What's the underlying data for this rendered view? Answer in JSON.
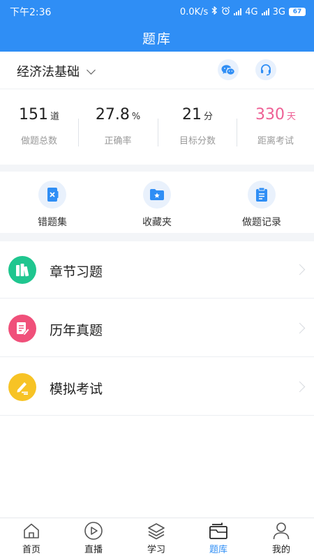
{
  "status_bar": {
    "time": "下午2:36",
    "network_speed": "0.0K/s",
    "net1": "4G",
    "net2": "3G",
    "battery": "67"
  },
  "header": {
    "title": "题库"
  },
  "subject": {
    "name": "经济法基础"
  },
  "stats": [
    {
      "value": "151",
      "unit": "道",
      "label": "做题总数"
    },
    {
      "value": "27.8",
      "unit": "%",
      "label": "正确率"
    },
    {
      "value": "21",
      "unit": "分",
      "label": "目标分数"
    },
    {
      "value": "330",
      "unit": "天",
      "label": "距离考试"
    }
  ],
  "tools": [
    {
      "label": "错题集",
      "icon": "wrong-questions-icon"
    },
    {
      "label": "收藏夹",
      "icon": "favorites-folder-icon"
    },
    {
      "label": "做题记录",
      "icon": "record-clipboard-icon"
    }
  ],
  "menu": [
    {
      "label": "章节习题",
      "icon": "books-icon",
      "color": "#1fc68f"
    },
    {
      "label": "历年真题",
      "icon": "paper-pen-icon",
      "color": "#f0507a"
    },
    {
      "label": "模拟考试",
      "icon": "exam-pen-icon",
      "color": "#f7c325"
    }
  ],
  "tabbar": {
    "items": [
      {
        "label": "首页",
        "icon": "home-icon"
      },
      {
        "label": "直播",
        "icon": "play-icon"
      },
      {
        "label": "学习",
        "icon": "layers-icon"
      },
      {
        "label": "题库",
        "icon": "question-bank-icon"
      },
      {
        "label": "我的",
        "icon": "profile-icon"
      }
    ],
    "active_index": 3
  },
  "colors": {
    "primary": "#2f8ef5",
    "highlight_pink": "#ee5f94",
    "green": "#1fc68f",
    "red": "#f0507a",
    "yellow": "#f7c325"
  }
}
